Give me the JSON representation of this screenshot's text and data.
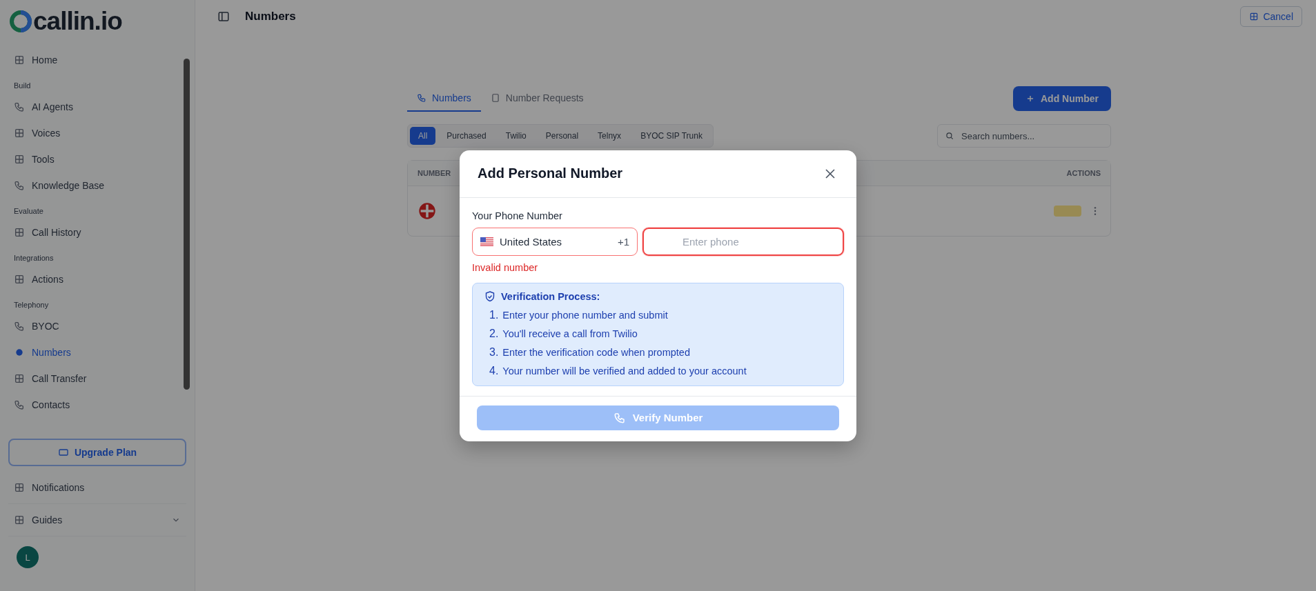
{
  "sidebar": {
    "logo": "callin.io",
    "sections": [
      {
        "items": [
          {
            "label": "Home",
            "selected": false
          }
        ]
      },
      {
        "title": "Build",
        "items": [
          {
            "label": "AI Agents",
            "selected": false
          },
          {
            "label": "Voices",
            "selected": false
          },
          {
            "label": "Tools",
            "selected": false
          },
          {
            "label": "Knowledge Base",
            "selected": false
          }
        ]
      },
      {
        "title": "Evaluate",
        "items": [
          {
            "label": "Call History",
            "selected": false
          }
        ]
      },
      {
        "title": "Integrations",
        "items": [
          {
            "label": "Actions",
            "selected": false
          }
        ]
      },
      {
        "title": "Telephony",
        "items": [
          {
            "label": "BYOC",
            "selected": false
          },
          {
            "label": "Numbers",
            "selected": true
          },
          {
            "label": "Call Transfer",
            "selected": false
          },
          {
            "label": "Contacts",
            "selected": false
          }
        ]
      }
    ],
    "upgrade_button": "Upgrade Plan",
    "footer_items": [
      {
        "label": "Notifications",
        "expandable": false
      },
      {
        "label": "Guides",
        "expandable": true
      }
    ],
    "user": {
      "initial": "L"
    }
  },
  "header": {
    "title": "Numbers",
    "cancel_button": "Cancel"
  },
  "tabs": [
    {
      "label": "Numbers",
      "selected": true
    },
    {
      "label": "Number Requests",
      "selected": false
    }
  ],
  "add_button": "Add Number",
  "filters": [
    {
      "label": "All",
      "selected": true
    },
    {
      "label": "Purchased",
      "selected": false
    },
    {
      "label": "Twilio",
      "selected": false
    },
    {
      "label": "Personal",
      "selected": false
    },
    {
      "label": "Telnyx",
      "selected": false
    },
    {
      "label": "BYOC SIP Trunk",
      "selected": false
    }
  ],
  "search": {
    "placeholder": "Search numbers..."
  },
  "table": {
    "columns": [
      "NUMBER",
      "ACTIONS"
    ]
  },
  "dialog": {
    "title": "Add Personal Number",
    "field_label": "Your Phone Number",
    "country": {
      "name": "United States",
      "code": "+1"
    },
    "phone": {
      "placeholder": "Enter phone",
      "invalid": true
    },
    "error": "Invalid number",
    "info": {
      "title": "Verification Process:",
      "steps": [
        {
          "number": "1.",
          "text": "Enter your phone number and submit"
        },
        {
          "number": "2.",
          "text": "You'll receive a call from Twilio"
        },
        {
          "number": "3.",
          "text": "Enter the verification code when prompted"
        },
        {
          "number": "4.",
          "text": "Your number will be verified and added to your account"
        }
      ]
    },
    "submit": {
      "label": "Verify Number",
      "disabled": true
    }
  }
}
